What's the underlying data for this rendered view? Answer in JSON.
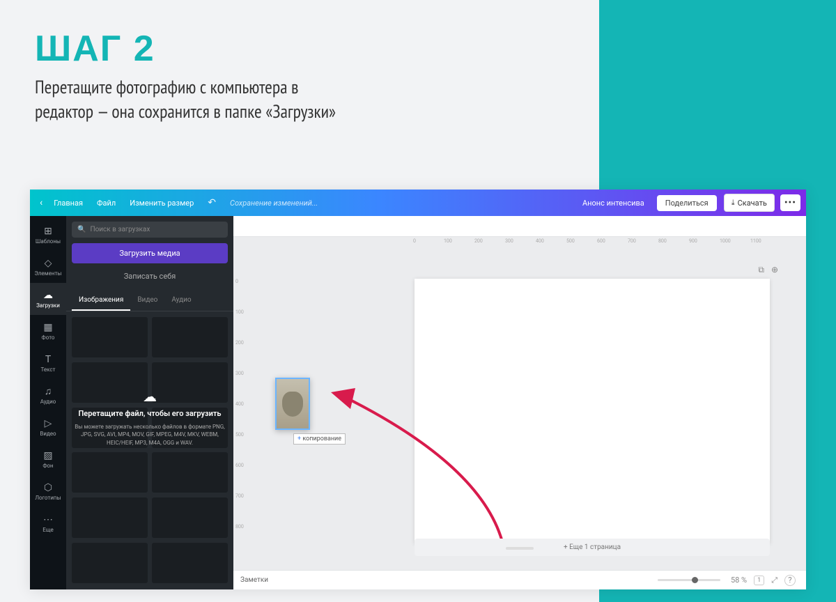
{
  "slide": {
    "title": "ШАГ 2",
    "description": "Перетащите фотографию с компьютера в\nредактор — она сохранится в папке «Загрузки»"
  },
  "topbar": {
    "back": "‹",
    "home": "Главная",
    "file": "Файл",
    "resize": "Изменить размер",
    "undo": "↶",
    "status": "Сохранение изменений...",
    "announce": "Анонс интенсива",
    "share": "Поделиться",
    "download_icon": "⤓",
    "download": "Скачать",
    "more": "•••"
  },
  "rail": {
    "items": [
      {
        "icon": "⊞",
        "label": "Шаблоны"
      },
      {
        "icon": "◇",
        "label": "Элементы"
      },
      {
        "icon": "☁",
        "label": "Загрузки"
      },
      {
        "icon": "▦",
        "label": "Фото"
      },
      {
        "icon": "T",
        "label": "Текст"
      },
      {
        "icon": "♫",
        "label": "Аудио"
      },
      {
        "icon": "▷",
        "label": "Видео"
      },
      {
        "icon": "▨",
        "label": "Фон"
      },
      {
        "icon": "⬡",
        "label": "Логотипы"
      },
      {
        "icon": "⋯",
        "label": "Еще"
      }
    ],
    "active_index": 2
  },
  "panel": {
    "search_placeholder": "Поиск в загрузках",
    "upload": "Загрузить медиа",
    "record": "Записать себя",
    "tabs": [
      "Изображения",
      "Видео",
      "Аудио"
    ],
    "active_tab": 0,
    "drop_title": "Перетащите файл, чтобы его загрузить",
    "drop_hint": "Вы можете загружать несколько файлов в формате PNG, JPG, SVG, AVI, MP4, MOV, GIF, MPEG, M4V, MKV, WEBM, HEIC/HEIF, MP3, M4A, OGG и WAV.",
    "collapse": "‹"
  },
  "canvas": {
    "ruler_ticks_h": [
      "0",
      "100",
      "200",
      "300",
      "400",
      "500",
      "600",
      "700",
      "800",
      "900",
      "1000",
      "1100"
    ],
    "ruler_ticks_v": [
      "0",
      "100",
      "200",
      "300",
      "400",
      "500",
      "600",
      "700",
      "800"
    ],
    "copy_label": "копирование",
    "copy_plus": "+",
    "add_page": "+ Еще 1 страница",
    "action_copy": "⧉",
    "action_new": "⊕"
  },
  "footer": {
    "notes": "Заметки",
    "zoom": "58 %",
    "pages_icon": "1",
    "expand": "⤢",
    "help": "?"
  }
}
